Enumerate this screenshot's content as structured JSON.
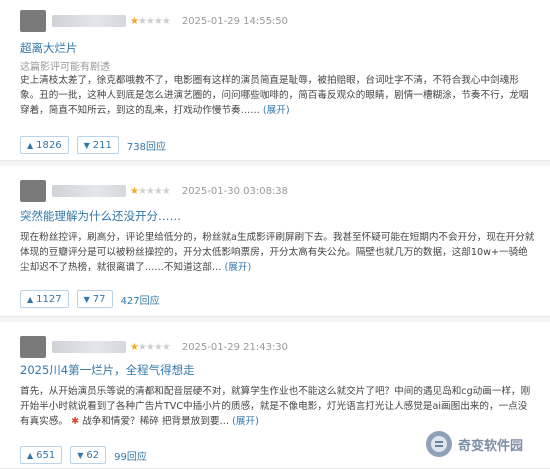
{
  "reviews": [
    {
      "date": "2025-01-29 14:55:50",
      "title": "超离大烂片",
      "spoiler": "这篇影评可能有剧透",
      "body": "史上清枝太差了，徐克都哦教不了，电影圈有这样的演员简直是耻辱，被拍赔眼，台词吐字不清，不符合我心中剑魂形象。丑的一批，这种人到底是怎么进演艺圈的，问问哪些咖啡的，简百毒反观众的眼睛，剧情一槽糊涂，节奏不行，龙咽穿着，简直不知所云，到这的乱来，打戏动作慢节奏……",
      "expand": "(展开)",
      "up": "1826",
      "down": "211",
      "replies": "738回应"
    },
    {
      "date": "2025-01-30 03:08:38",
      "title": "突然能理解为什么还没开分……",
      "spoiler": "",
      "body": "现在粉丝控评，刷高分，评论里给低分的，粉丝就a生成影评刷屏刷下去。我甚至怀疑可能在短期内不会开分，现在开分就体现的豆瓣评分是可以被粉丝操控的，开分太低影响票房，开分太高有失公允。隔壁也就几万的数据，这部10w+一骑绝尘却迟不了热榜，就很离谱了……不知道这部…",
      "expand": "(展开)",
      "up": "1127",
      "down": "77",
      "replies": "427回应"
    },
    {
      "date": "2025-01-29 21:43:30",
      "title": "2025川4第一烂片，全程气得想走",
      "spoiler": "",
      "body": "首先，从开始演员乐等说的清都和配音层硬不对，就算学生作业也不能这么就交片了吧？中间的遇见岛和cg动画一样，刚开始半小时就说看到了各种广告片TVC中插小片的质感，就是不像电影，灯光语言打光让人感觉是ai画图出来的，一点没有真实感。",
      "body_tail": "战争和情爱？稀碎 把背景放到要…",
      "expand": "(展开)",
      "up": "651",
      "down": "62",
      "replies": "99回应"
    }
  ],
  "watermark": {
    "text": "奇变软件园"
  },
  "colors": {
    "link": "#3377aa",
    "star": "#f5a623",
    "text": "#444444"
  }
}
